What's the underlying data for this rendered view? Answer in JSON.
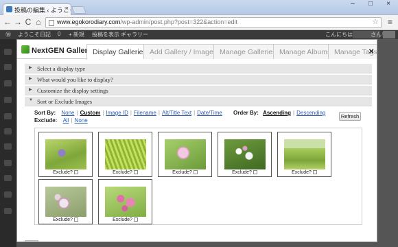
{
  "browser": {
    "tab_title": "投稿の編集 ‹ ようこそ日記 –",
    "tab_close": "×",
    "url_host": "www.egokorodiary.com",
    "url_path": "/wp-admin/post.php?post=322&action=edit",
    "back": "←",
    "forward": "→",
    "reload": "C",
    "home": "⌂",
    "star": "☆",
    "menu": "≡",
    "win_min": "–",
    "win_max": "□",
    "win_close": "×"
  },
  "adminbar": {
    "wp_logo": "Ⓦ",
    "site": "ようこそ日記",
    "comments": "0",
    "new": "+ 新規",
    "view": "投稿を表示",
    "gallery": "ギャラリー",
    "greeting": "こんにちは、",
    "greeting_suffix": "さん！"
  },
  "modal": {
    "brand": "NextGEN Gallery",
    "close": "×",
    "tabs": [
      {
        "label": "Display Galleries"
      },
      {
        "label": "Add Gallery / Images"
      },
      {
        "label": "Manage Galleries"
      },
      {
        "label": "Manage Albums"
      },
      {
        "label": "Manage Tags"
      }
    ],
    "accordion": [
      {
        "label": "Select a display type"
      },
      {
        "label": "What would you like to display?"
      },
      {
        "label": "Customize the display settings"
      },
      {
        "label": "Sort or Exclude Images"
      }
    ],
    "sort": {
      "sort_by_label": "Sort By:",
      "sort_options": [
        "None",
        "Custom",
        "Image ID",
        "Filename",
        "Alt/Title Text",
        "Date/Time"
      ],
      "selected_sort": "Custom",
      "order_by_label": "Order By:",
      "order_options": [
        "Ascending",
        "Descending"
      ],
      "selected_order": "Ascending",
      "exclude_label": "Exclude:",
      "exclude_options": [
        "All",
        "None"
      ],
      "refresh": "Refresh"
    },
    "thumbnails": [
      {
        "caption": "Exclude?",
        "icon": "flower-photo-1"
      },
      {
        "caption": "Exclude?",
        "icon": "grass-photo"
      },
      {
        "caption": "Exclude?",
        "icon": "clover-flower-photo"
      },
      {
        "caption": "Exclude?",
        "icon": "white-flower-photo"
      },
      {
        "caption": "Exclude?",
        "icon": "meadow-photo"
      },
      {
        "caption": "Exclude?",
        "icon": "pink-cluster-photo"
      },
      {
        "caption": "Exclude?",
        "icon": "pink-flowers-photo"
      }
    ]
  }
}
